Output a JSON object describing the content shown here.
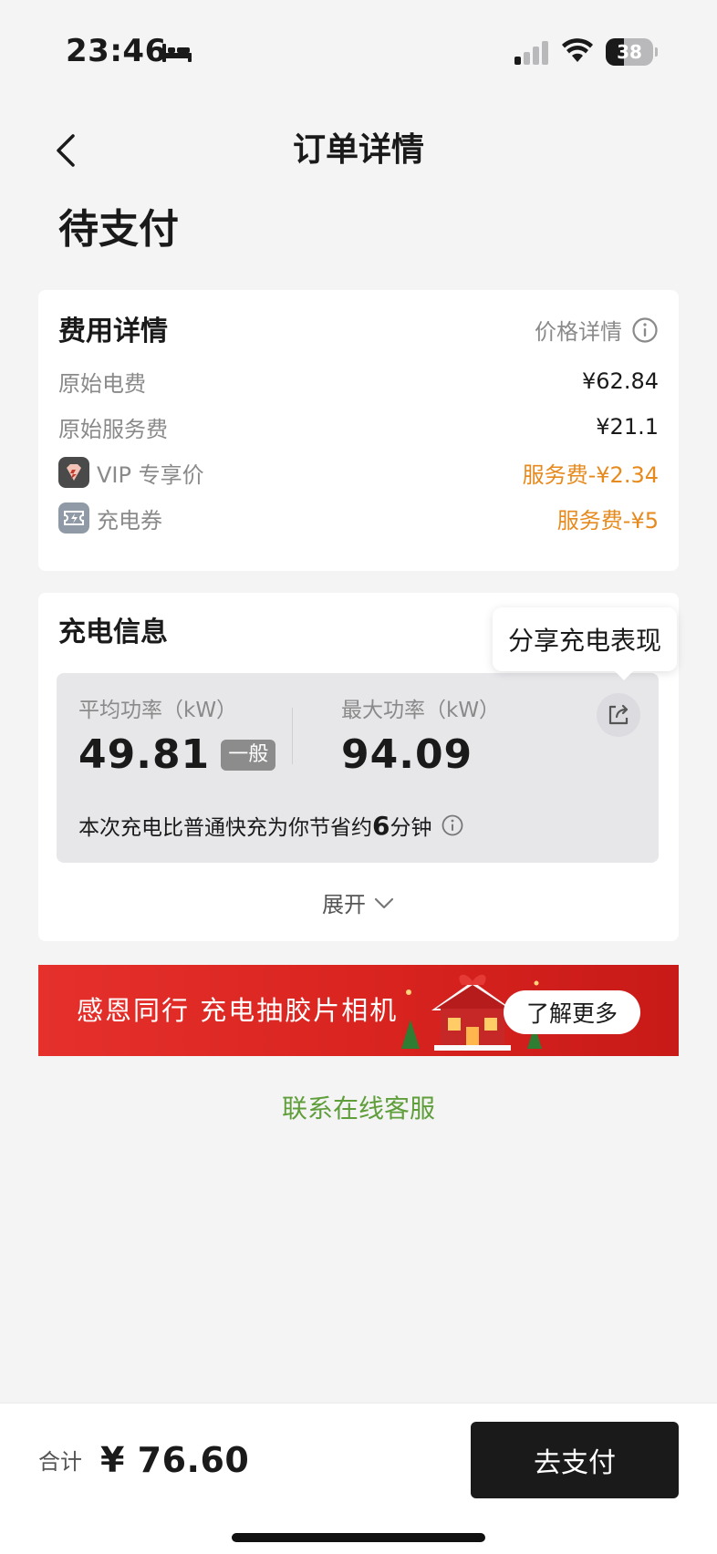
{
  "status_bar": {
    "time": "23:46",
    "battery_level": "38",
    "battery_fraction": 0.38
  },
  "nav": {
    "title": "订单详情"
  },
  "order": {
    "status": "待支付"
  },
  "fee_details": {
    "title": "费用详情",
    "price_detail_link": "价格详情",
    "rows": [
      {
        "label": "原始电费",
        "value": "¥62.84"
      },
      {
        "label": "原始服务费",
        "value": "¥21.1"
      },
      {
        "label": "VIP 专享价",
        "value": "服务费-¥2.34",
        "icon": "vip-diamond-icon"
      },
      {
        "label": "充电券",
        "value": "服务费-¥5",
        "icon": "coupon-icon"
      }
    ]
  },
  "charging_info": {
    "title": "充电信息",
    "avg_power": {
      "label": "平均功率（kW）",
      "value": "49.81",
      "badge": "一般"
    },
    "max_power": {
      "label": "最大功率（kW）",
      "value": "94.09"
    },
    "saving_note": {
      "prefix": "本次充电比普通快充为你节省约",
      "amount": "6",
      "suffix": "分钟"
    },
    "expand_label": "展开",
    "share_tooltip": "分享充电表现"
  },
  "banner": {
    "text": "感恩同行 充电抽胶片相机",
    "button_label": "了解更多"
  },
  "contact_link": "联系在线客服",
  "bottom_bar": {
    "total_label": "合计",
    "total_value": "¥ 76.60",
    "pay_label": "去支付"
  },
  "colors": {
    "discount": "#e68a1e",
    "contact": "#5f9e3a",
    "banner_red": "#d8231f",
    "pay_button": "#1a1a1a"
  }
}
